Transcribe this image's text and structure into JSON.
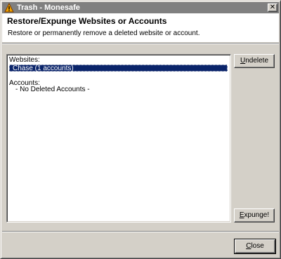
{
  "window": {
    "title": "Trash - Monesafe",
    "title_icon": "warning-icon",
    "close_glyph": "✕"
  },
  "header": {
    "title": "Restore/Expunge Websites or Accounts",
    "subtitle": "Restore or permanently remove a deleted website or account."
  },
  "list": {
    "websites_heading": "Websites:",
    "selected_item": "Chase (1 accounts)",
    "accounts_heading": "Accounts:",
    "accounts_empty": "- No Deleted Accounts -"
  },
  "buttons": {
    "undelete": {
      "accel": "U",
      "rest": "ndelete"
    },
    "expunge": {
      "accel": "E",
      "rest": "xpunge!"
    },
    "close": {
      "accel": "C",
      "rest": "lose"
    }
  },
  "colors": {
    "titlebar_inactive": "#808080",
    "selection": "#0a246a",
    "face": "#d4d0c8"
  }
}
